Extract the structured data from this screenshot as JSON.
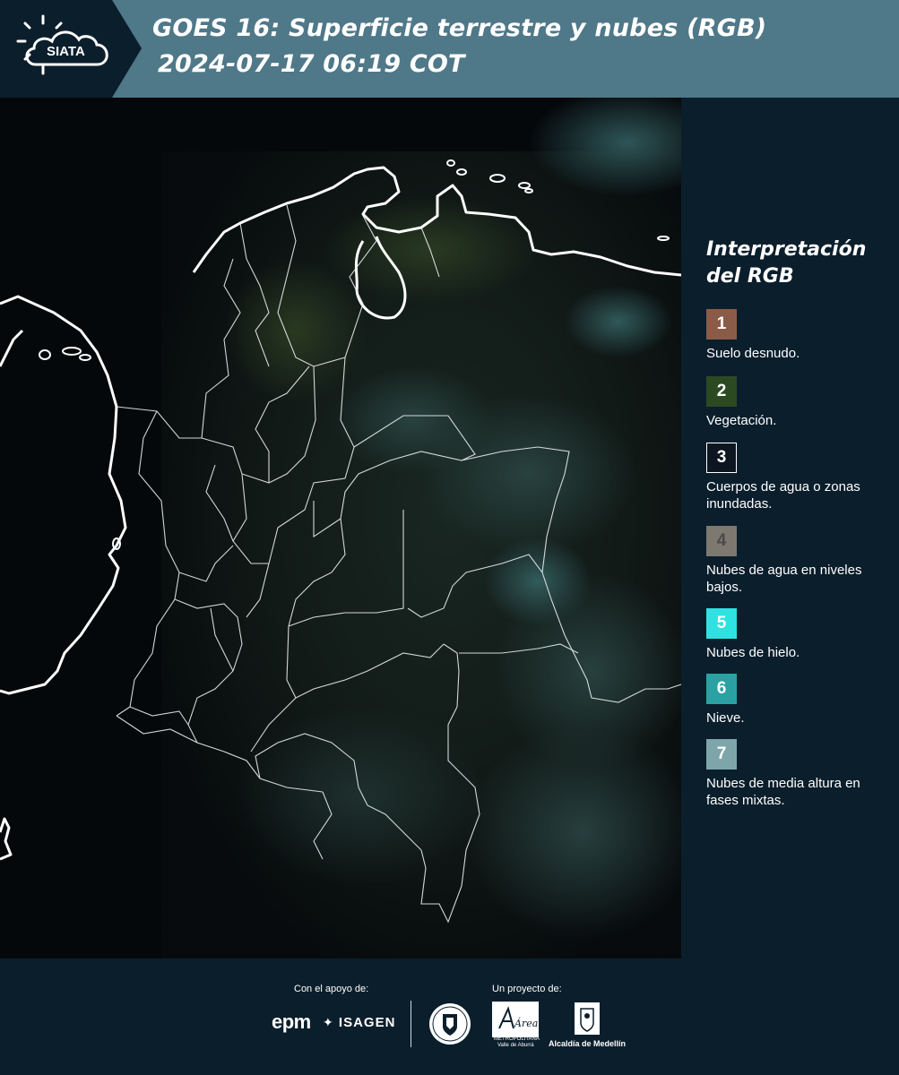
{
  "header": {
    "logo_text": "SIATA",
    "title_line1": "GOES 16: Superficie terrestre y nubes (RGB)",
    "title_line2": "2024-07-17 06:19 COT",
    "background_color": "#4f7888"
  },
  "legend": {
    "title": "Interpretación del RGB",
    "items": [
      {
        "number": "1",
        "label": "Suelo desnudo.",
        "color": "#8a5c48"
      },
      {
        "number": "2",
        "label": "Vegetación.",
        "color": "#2c4a22"
      },
      {
        "number": "3",
        "label": "Cuerpos de agua o zonas inundadas.",
        "color": "#0d1620"
      },
      {
        "number": "4",
        "label": "Nubes de agua en niveles bajos.",
        "color": "#7d7870"
      },
      {
        "number": "5",
        "label": "Nubes de hielo.",
        "color": "#2fe2e2"
      },
      {
        "number": "6",
        "label": "Nieve.",
        "color": "#2aa1a3"
      },
      {
        "number": "7",
        "label": "Nubes de media altura en fases mixtas.",
        "color": "#7ea6aa"
      }
    ]
  },
  "footer": {
    "support_label": "Con el apoyo de:",
    "project_label": "Un proyecto de:",
    "sponsors": [
      "epm",
      "ISAGEN"
    ],
    "partners": [
      "Medellín",
      "Área Metropolitana Valle de Aburrá",
      "Alcaldía de Medellín"
    ],
    "area_text_line1": "METROPOLITANA",
    "area_text_line2": "Valle de Aburrá",
    "area_script": "Área",
    "alcaldia_text": "Alcaldía de Medellín"
  },
  "map": {
    "description_icon": "satellite-rgb-map",
    "border_color": "#ffffff"
  }
}
